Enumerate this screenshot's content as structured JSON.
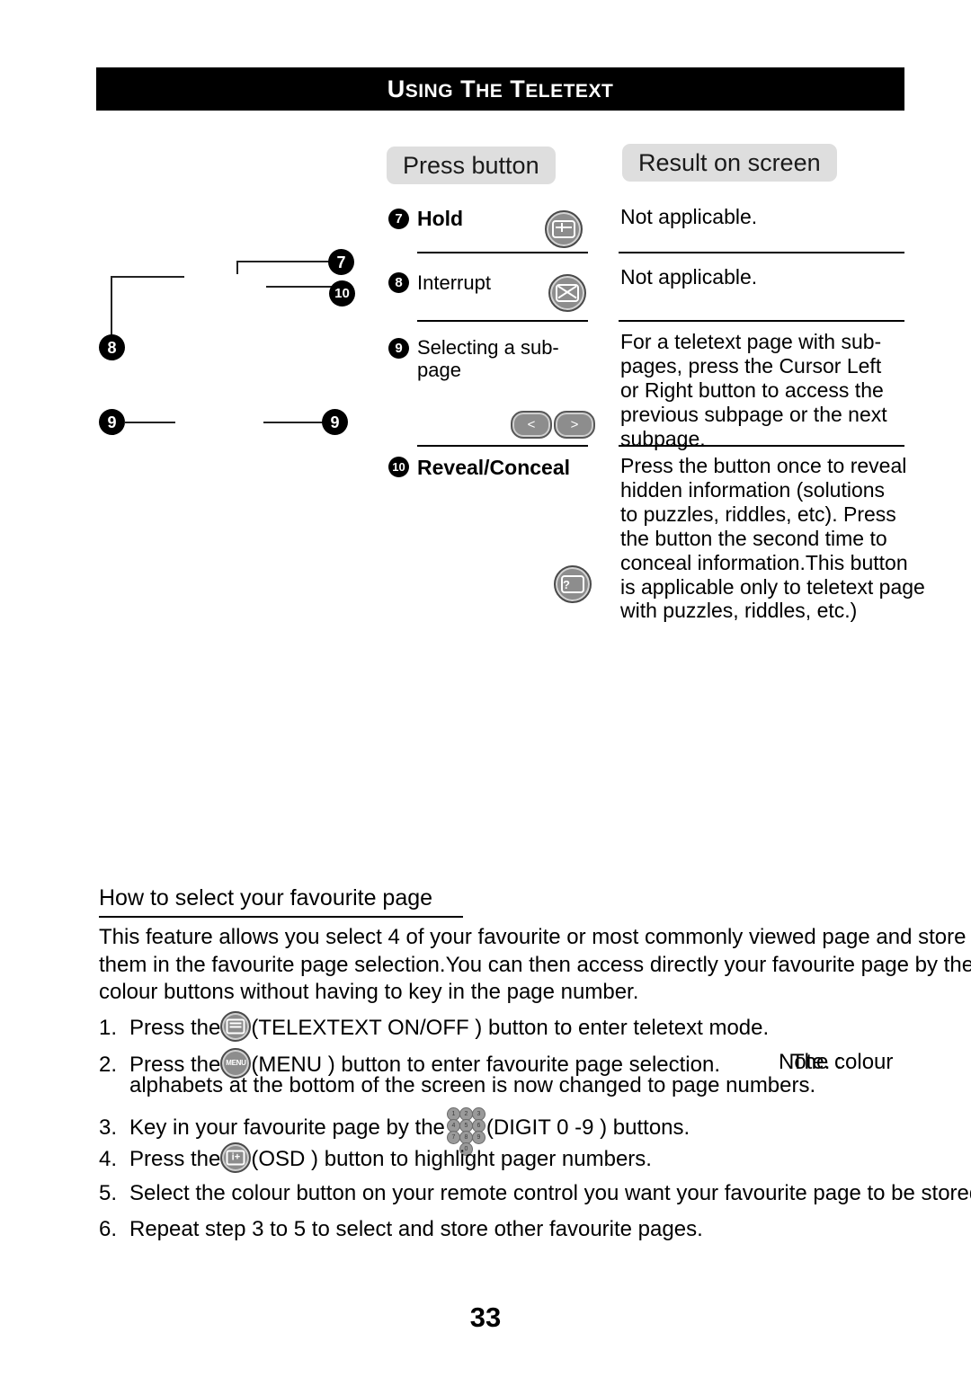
{
  "page": {
    "banner_title_parts": [
      "U",
      "SING ",
      "T",
      "HE ",
      "T",
      "ELETEXT"
    ],
    "banner_title": "USING THE TELETEXT",
    "number": "33"
  },
  "columns": {
    "press_button": "Press button",
    "result_on_screen": "Result on screen"
  },
  "rows": [
    {
      "index": "7",
      "label": "Hold",
      "bold": true,
      "button_icon": "hold-icon",
      "result": "Not applicable."
    },
    {
      "index": "8",
      "label": "Interrupt",
      "bold": false,
      "button_icon": "interrupt-icon",
      "result": "Not applicable."
    },
    {
      "index": "9",
      "label": "Selecting a sub-\npage",
      "bold": false,
      "button_icon": "cursor-left-right-icon",
      "cursor_left": "<",
      "cursor_right": ">",
      "result": "For a teletext page with sub-\npages, press the Cursor  Left\nor Right  button to access the\nprevious subpage or the next\nsubpage."
    },
    {
      "index": "10",
      "label": "Reveal/Conceal",
      "bold": true,
      "button_icon": "reveal-conceal-icon",
      "result": "Press the button once to reveal\nhidden information (solutions\nto puzzles, riddles, etc). Press\nthe button the second time to\nconceal information.This button\nis applicable only to teletext page\nwith puzzles, riddles, etc.)"
    }
  ],
  "callouts": [
    {
      "id": "callout-7",
      "label": "7"
    },
    {
      "id": "callout-10",
      "label": "10"
    },
    {
      "id": "callout-8",
      "label": "8"
    },
    {
      "id": "callout-9-left",
      "label": "9"
    },
    {
      "id": "callout-9-right",
      "label": "9"
    }
  ],
  "favourite": {
    "heading": "How to select your favourite page",
    "paragraph": "This feature allows you select 4 of your favourite or most commonly viewed page and store\nthem in the favourite page selection.You can then access directly your favourite page by the\ncolour buttons without having to key in the page number.",
    "steps": [
      {
        "num": "1.",
        "before": "Press the",
        "icon": "teletext-on-off-icon",
        "after": "(TELEXTEXT ON/OFF    ) button to enter teletext mode."
      },
      {
        "num": "2.",
        "before": "Press the",
        "icon": "menu-icon",
        "after": "(MENU ) button to enter favourite page selection.",
        "overlap": "Note. :",
        "tail": "The colour",
        "line2": "alphabets at the bottom of the screen is now changed to page numbers."
      },
      {
        "num": "3.",
        "before": "Key in your favourite page by the",
        "icon": "digit-keypad-icon",
        "after": "(DIGIT 0 -9 ) buttons."
      },
      {
        "num": "4.",
        "before": "Press the",
        "icon": "osd-icon",
        "after": "(OSD ) button to highlight pager numbers."
      },
      {
        "num": "5.",
        "before": "Select the colour button on your remote control you want your favourite page to be stored.",
        "icon": "",
        "after": ""
      },
      {
        "num": "6.",
        "before": "Repeat step 3  to 5 to select and store other favourite pages.",
        "icon": "",
        "after": ""
      }
    ]
  },
  "keypad_digits": [
    "1",
    "2",
    "3",
    "4",
    "5",
    "6",
    "7",
    "8",
    "9",
    "0"
  ]
}
